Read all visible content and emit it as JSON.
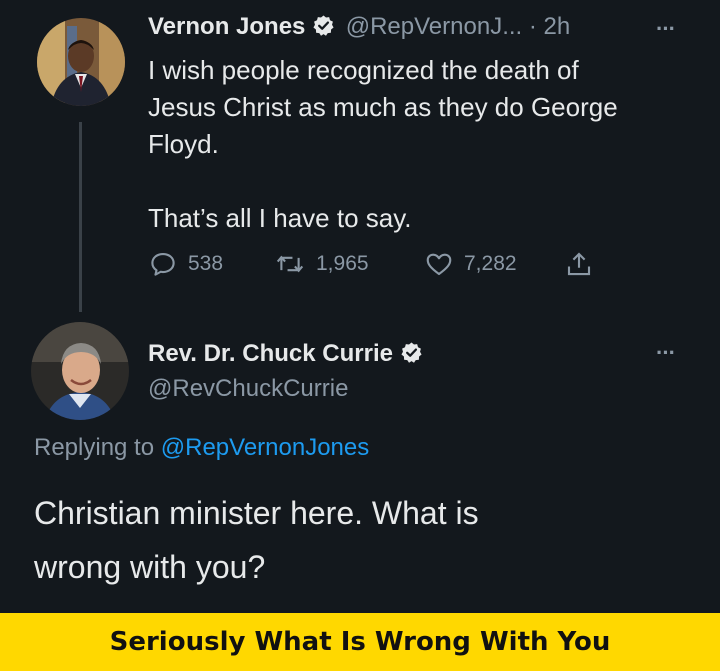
{
  "tweet": {
    "author_name": "Vernon Jones",
    "handle_time": "@RepVernonJ... · 2h",
    "more": "···",
    "text_line1": "I wish people recognized the death of",
    "text_line2": "Jesus Christ as much as they do George",
    "text_line3": "Floyd.",
    "text_line4": "That’s all I have to say.",
    "replies": "538",
    "retweets": "1,965",
    "likes": "7,282"
  },
  "reply": {
    "author_name": "Rev. Dr. Chuck Currie",
    "handle": "@RevChuckCurrie",
    "more": "···",
    "replying_to_label": "Replying to",
    "replying_to_handle": "@RepVernonJones",
    "text_line1": "Christian minister here. What is",
    "text_line2": "wrong with you?"
  },
  "caption": "Seriously What Is Wrong With You",
  "colors": {
    "background": "#13181d",
    "link": "#1d9bf0",
    "caption_bar": "#ffd800",
    "muted": "#8b98a5"
  }
}
